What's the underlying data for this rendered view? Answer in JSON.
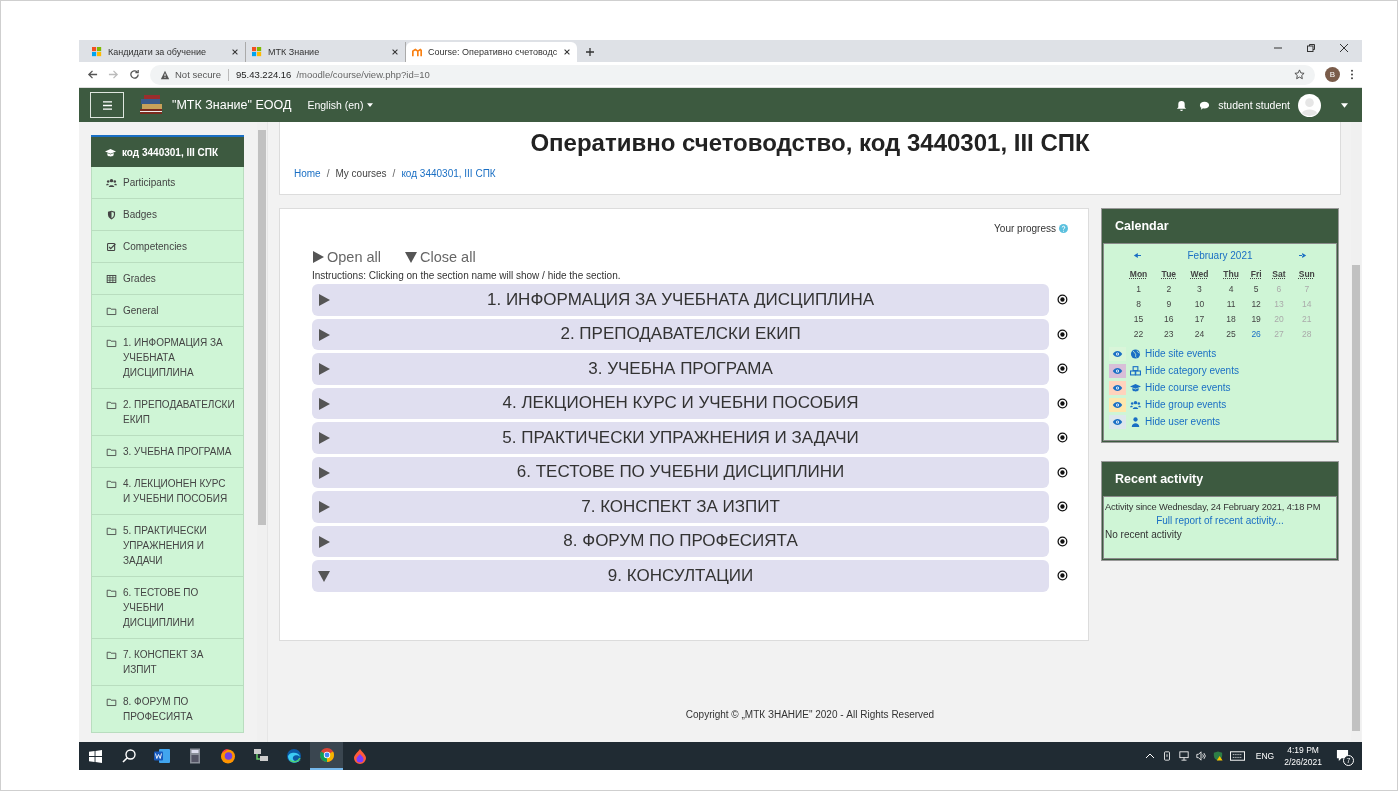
{
  "browser": {
    "tabs": [
      {
        "label": "Кандидати за обучение",
        "selected": false
      },
      {
        "label": "МТК Знание",
        "selected": false
      },
      {
        "label": "Course: Оперативно счетоводс",
        "selected": true
      }
    ],
    "security": "Not secure",
    "url_host": "95.43.224.16",
    "url_path": "/moodle/course/view.php?id=10",
    "profile": "B"
  },
  "navbar": {
    "site_name": "\"МТК Знание\" ЕООД",
    "language": "English (en)",
    "user": "student student"
  },
  "drawer": [
    {
      "label": "код 3440301, III СПК",
      "kind": "course",
      "selected": true
    },
    {
      "label": "Participants",
      "kind": "users",
      "selected": false
    },
    {
      "label": "Badges",
      "kind": "shield",
      "selected": false
    },
    {
      "label": "Competencies",
      "kind": "check",
      "selected": false
    },
    {
      "label": "Grades",
      "kind": "table",
      "selected": false
    },
    {
      "label": "General",
      "kind": "folder",
      "selected": false
    },
    {
      "label": "1. ИНФОРМАЦИЯ ЗА УЧЕБНАТА ДИСЦИПЛИНА",
      "kind": "folder",
      "selected": false
    },
    {
      "label": "2. ПРЕПОДАВАТЕЛСКИ ЕКИП",
      "kind": "folder",
      "selected": false
    },
    {
      "label": "3. УЧЕБНА ПРОГРАМА",
      "kind": "folder",
      "selected": false
    },
    {
      "label": "4. ЛЕКЦИОНЕН КУРС И УЧЕБНИ ПОСОБИЯ",
      "kind": "folder",
      "selected": false
    },
    {
      "label": "5. ПРАКТИЧЕСКИ УПРАЖНЕНИЯ И ЗАДАЧИ",
      "kind": "folder",
      "selected": false
    },
    {
      "label": "6. ТЕСТОВЕ ПО УЧЕБНИ ДИСЦИПЛИНИ",
      "kind": "folder",
      "selected": false
    },
    {
      "label": "7. КОНСПЕКТ ЗА ИЗПИТ",
      "kind": "folder",
      "selected": false
    },
    {
      "label": "8. ФОРУМ ПО ПРОФЕСИЯТА",
      "kind": "folder",
      "selected": false
    }
  ],
  "course": {
    "title": "Оперативно счетоводство, код 3440301, III СПК",
    "breadcrumb": [
      {
        "label": "Home",
        "link": true
      },
      {
        "separator": "/",
        "label": "My courses",
        "link": false
      },
      {
        "separator": "/",
        "label": "код 3440301, III СПК",
        "link": true
      }
    ],
    "progress_label": "Your progress",
    "open_all": "Open all",
    "close_all": "Close all",
    "instructions": "Instructions: Clicking on the section name will show / hide the section.",
    "sections": [
      {
        "title": "1. ИНФОРМАЦИЯ ЗА УЧЕБНАТА ДИСЦИПЛИНА",
        "expanded": false
      },
      {
        "title": "2. ПРЕПОДАВАТЕЛСКИ ЕКИП",
        "expanded": false
      },
      {
        "title": "3. УЧЕБНА ПРОГРАМА",
        "expanded": false
      },
      {
        "title": "4. ЛЕКЦИОНЕН КУРС И УЧЕБНИ ПОСОБИЯ",
        "expanded": false
      },
      {
        "title": "5. ПРАКТИЧЕСКИ УПРАЖНЕНИЯ И ЗАДАЧИ",
        "expanded": false
      },
      {
        "title": "6. ТЕСТОВЕ ПО УЧЕБНИ ДИСЦИПЛИНИ",
        "expanded": false
      },
      {
        "title": "7. КОНСПЕКТ ЗА ИЗПИТ",
        "expanded": false
      },
      {
        "title": "8. ФОРУМ ПО ПРОФЕСИЯТА",
        "expanded": false
      },
      {
        "title": "9. КОНСУЛТАЦИИ",
        "expanded": true
      }
    ]
  },
  "calendar": {
    "title": "Calendar",
    "month": "February 2021",
    "weekdays": [
      "Mon",
      "Tue",
      "Wed",
      "Thu",
      "Fri",
      "Sat",
      "Sun"
    ],
    "weeks": [
      [
        {
          "day": "1",
          "today": false
        },
        {
          "day": "2",
          "today": false
        },
        {
          "day": "3",
          "today": false
        },
        {
          "day": "4",
          "today": false
        },
        {
          "day": "5",
          "today": false
        },
        {
          "day": "6",
          "today": false
        },
        {
          "day": "7",
          "today": false
        }
      ],
      [
        {
          "day": "8",
          "today": false
        },
        {
          "day": "9",
          "today": false
        },
        {
          "day": "10",
          "today": false
        },
        {
          "day": "11",
          "today": false
        },
        {
          "day": "12",
          "today": false
        },
        {
          "day": "13",
          "today": false
        },
        {
          "day": "14",
          "today": false
        }
      ],
      [
        {
          "day": "15",
          "today": false
        },
        {
          "day": "16",
          "today": false
        },
        {
          "day": "17",
          "today": false
        },
        {
          "day": "18",
          "today": false
        },
        {
          "day": "19",
          "today": false
        },
        {
          "day": "20",
          "today": false
        },
        {
          "day": "21",
          "today": false
        }
      ],
      [
        {
          "day": "22",
          "today": false
        },
        {
          "day": "23",
          "today": false
        },
        {
          "day": "24",
          "today": false
        },
        {
          "day": "25",
          "today": false
        },
        {
          "day": "26",
          "today": true
        },
        {
          "day": "27",
          "today": false
        },
        {
          "day": "28",
          "today": false
        }
      ]
    ],
    "filters": [
      {
        "label": "Hide site events",
        "kind": "globe",
        "color": "#d9f5d9"
      },
      {
        "label": "Hide category events",
        "kind": "cubes",
        "color": "#d8bfd8"
      },
      {
        "label": "Hide course events",
        "kind": "cap",
        "color": "#ffd3bd"
      },
      {
        "label": "Hide group events",
        "kind": "users",
        "color": "#fee7ae"
      },
      {
        "label": "Hide user events",
        "kind": "user",
        "color": "#dce7ec"
      }
    ]
  },
  "recent": {
    "title": "Recent activity",
    "since": "Activity since Wednesday, 24 February 2021, 4:18 PM",
    "report_link": "Full report of recent activity...",
    "empty": "No recent activity"
  },
  "footer": "Copyright © „МТК ЗНАНИЕ\" 2020 - All Rights Reserved",
  "taskbar": {
    "apps": [
      {
        "kind": "search",
        "active": false
      },
      {
        "kind": "word",
        "active": false
      },
      {
        "kind": "calculator",
        "active": false
      },
      {
        "kind": "firefox",
        "active": false
      },
      {
        "kind": "network",
        "active": false
      },
      {
        "kind": "edge",
        "active": false
      },
      {
        "kind": "chrome",
        "active": true
      },
      {
        "kind": "drop",
        "active": false
      }
    ],
    "language": "ENG",
    "time": "4:19 PM",
    "date": "2/26/2021",
    "notifications": "7"
  }
}
